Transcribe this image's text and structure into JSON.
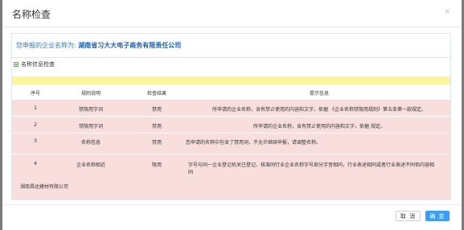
{
  "dialog": {
    "title": "名称检查",
    "close": "×",
    "applied_prefix": "您申报的企业名称为:",
    "applied_name": "湖南省习大大电子商务有限责任公司",
    "section_title": "名称信息检查",
    "table": {
      "headers": [
        "序号",
        "规则说明",
        "检查结果",
        "提示信息"
      ],
      "rows": [
        {
          "no": "1",
          "rule": "禁限用字词",
          "result": "禁用",
          "tip": "所申请的企业名称，含有禁止使用的内容和文字，依据 《企业名称禁限用规则》第五条第一款规定。"
        },
        {
          "no": "2",
          "rule": "禁限用字词",
          "result": "禁用",
          "tip": "所申请的企业名称，含有禁止使用的内容和文字，依据 规定。"
        },
        {
          "no": "3",
          "rule": "名称信息",
          "result": "禁用",
          "tip": "您申请的名称中包含了禁用词，不允许继续申报，请调整名称。"
        },
        {
          "no": "4",
          "rule": "企业名称相近",
          "result": "限用",
          "tip_line1": "字号与同一企业登记机关已登记、核准同行业企业名称字号部分字音相同，行业表述相同或者行业表述不同但内容相",
          "tip_line2": "同"
        }
      ],
      "similar_company": "湖南昌达建材有限公司"
    },
    "buttons": {
      "cancel": "取 消",
      "ok": "确 定"
    }
  },
  "colors": {
    "link_blue": "#2b78c6",
    "row_pink": "#f9dede",
    "warn_yellow": "#fbf59b",
    "primary": "#3d9df2"
  }
}
